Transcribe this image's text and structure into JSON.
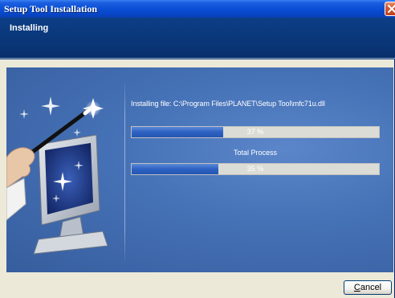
{
  "window": {
    "title": "Setup Tool Installation"
  },
  "header": {
    "heading": "Installing"
  },
  "main": {
    "installing_file_text": "Installing file: C:\\Program Files\\PLANET\\Setup Tool\\mfc71u.dll",
    "file_progress": {
      "value_percent": 37,
      "label": "37 %"
    },
    "total_label": "Total Process",
    "total_progress": {
      "value_percent": 35,
      "label": "35 %"
    }
  },
  "footer": {
    "cancel_mnemonic": "C",
    "cancel_rest": "ancel"
  },
  "colors": {
    "titlebar": "#0a4fd6",
    "header": "#0a3678",
    "panel": "#4672b7",
    "progress_fill": "#2e62c2",
    "progress_track": "#dcdcd6",
    "dialog_bg": "#ece9d8",
    "close_button": "#d45a33"
  },
  "icons": {
    "close": "close-icon",
    "illustration": "magic-wand-monitor-illustration"
  }
}
